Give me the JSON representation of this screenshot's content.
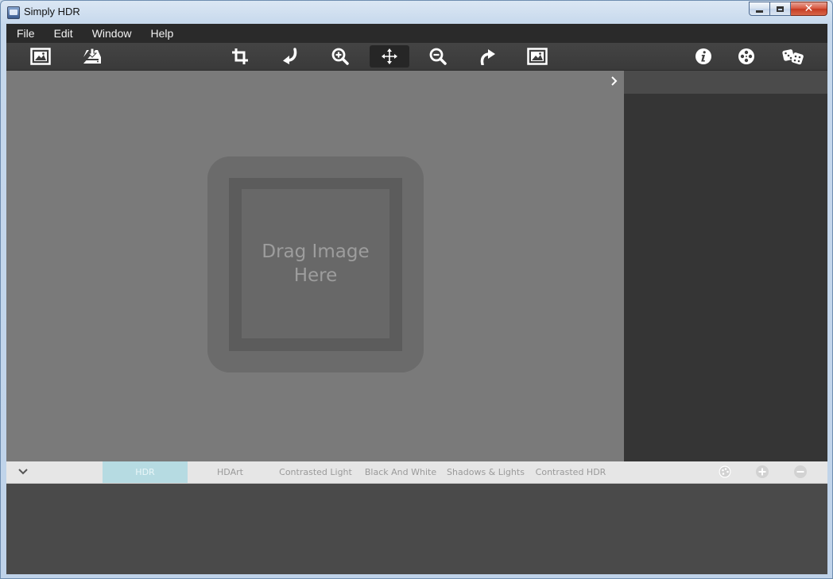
{
  "window": {
    "title": "Simply HDR"
  },
  "menu": [
    {
      "label": "File"
    },
    {
      "label": "Edit"
    },
    {
      "label": "Window"
    },
    {
      "label": "Help"
    }
  ],
  "toolbar": {
    "tools": [
      {
        "name": "open-image",
        "icon": "image-frame-icon"
      },
      {
        "name": "save",
        "icon": "tray-download-icon"
      },
      {
        "name": "crop",
        "icon": "crop-icon"
      },
      {
        "name": "rotate-left",
        "icon": "rotate-left-arrow-icon"
      },
      {
        "name": "zoom-in",
        "icon": "zoom-in-icon"
      },
      {
        "name": "move",
        "icon": "move-arrows-icon",
        "active": true
      },
      {
        "name": "zoom-out",
        "icon": "zoom-out-icon"
      },
      {
        "name": "rotate-right",
        "icon": "rotate-right-arrow-icon"
      },
      {
        "name": "fit-image",
        "icon": "image-frame-icon"
      },
      {
        "name": "info",
        "icon": "info-icon"
      },
      {
        "name": "film-reel",
        "icon": "film-reel-icon"
      },
      {
        "name": "random",
        "icon": "dice-icon"
      }
    ]
  },
  "canvas": {
    "drop_text_line1": "Drag Image",
    "drop_text_line2": "Here"
  },
  "presets": {
    "selected_index": 0,
    "tabs": [
      {
        "label": "HDR"
      },
      {
        "label": "HDArt"
      },
      {
        "label": "Contrasted Light"
      },
      {
        "label": "Black And White"
      },
      {
        "label": "Shadows & Lights"
      },
      {
        "label": "Contrasted HDR"
      }
    ],
    "actions": [
      {
        "icon": "palette-icon"
      },
      {
        "icon": "plus-icon"
      },
      {
        "icon": "minus-icon"
      }
    ]
  },
  "colors": {
    "canvas_bg": "#7a7a7a",
    "selected_tab": "#b6dbe2",
    "menubar_bg": "#2a2a2a",
    "side_panel_bg": "#353535"
  }
}
